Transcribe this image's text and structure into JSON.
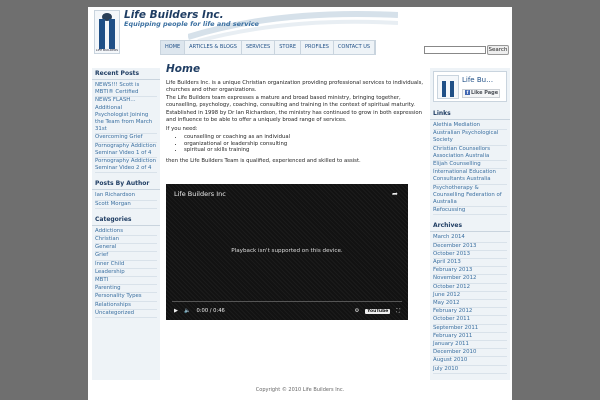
{
  "header": {
    "site_title": "Life Builders Inc.",
    "tagline": "Equipping people for life and service",
    "logo_word": "LIFE BUILDERS"
  },
  "nav": [
    "HOME",
    "ARTICLES & BLOGS",
    "SERVICES",
    "STORE",
    "PROFILES",
    "CONTACT US"
  ],
  "search": {
    "button_label": "Search",
    "value": ""
  },
  "left_sidebar": {
    "recent_posts": {
      "heading": "Recent Posts",
      "items": [
        "NEWS!!! Scott is MBTI® Certified",
        "NEWS FLASH… Additional Psychologist Joining the Team from March 31st",
        "Overcoming Grief",
        "Pornography Addiction Seminar Video 1 of 4",
        "Pornography Addiction Seminar Video 2 of 4"
      ]
    },
    "posts_by_author": {
      "heading": "Posts By Author",
      "items": [
        "Ian Richardson",
        "Scott Morgan"
      ]
    },
    "categories": {
      "heading": "Categories",
      "items": [
        "Addictions",
        "Christian",
        "General",
        "Grief",
        "Inner Child",
        "Leadership",
        "MBTI",
        "Parenting",
        "Personality Types",
        "Relationships",
        "Uncategorized"
      ]
    }
  },
  "right_sidebar": {
    "facebook": {
      "name": "Life Bu…",
      "like_label": "Like Page"
    },
    "links": {
      "heading": "Links",
      "items": [
        "Alethia Mediation",
        "Australian Psychological Society",
        "Christian Counsellors Association Australia",
        "Elijah Counselling",
        "International Education Consultants Australia",
        "Psychotherapy & Counselling Federation of Australia",
        "Refocussing"
      ]
    },
    "archives": {
      "heading": "Archives",
      "items": [
        "March 2014",
        "December 2013",
        "October 2013",
        "April 2013",
        "February 2013",
        "November 2012",
        "October 2012",
        "June 2012",
        "May 2012",
        "February 2012",
        "October 2011",
        "September 2011",
        "February 2011",
        "January 2011",
        "December 2010",
        "August 2010",
        "July 2010"
      ]
    }
  },
  "main": {
    "title": "Home",
    "p1": "Life Builders Inc. is a unique Christian organization providing professional services to individuals, churches and other organizations.",
    "p2": "The Life Builders team expresses a mature and broad based ministry, bringing together, counselling, psychology, coaching, consulting and training in the context of spiritual maturity.",
    "p3": "Established in 1998 by Dr Ian Richardson, the ministry has continued to grow in both expression and influence to be able to offer a uniquely broad range of services.",
    "p4": "If you need:",
    "bullets": [
      "counselling or coaching as an individual",
      "organizational or leadership consulting",
      "spiritual or skills training"
    ],
    "p5": "then the Life Builders Team is qualified, experienced and skilled to assist."
  },
  "video": {
    "title": "Life Builders Inc",
    "message": "Playback isn't supported on this device.",
    "time": "0:00 / 0:46",
    "yt_label": "YouTube"
  },
  "footer": {
    "copyright": "Copyright © 2010 Life Builders Inc."
  },
  "colors": {
    "accent": "#1f3d63",
    "link": "#3a6fa0",
    "sidebar_bg": "#eef3f7",
    "page_bg": "#6f6f6f"
  }
}
